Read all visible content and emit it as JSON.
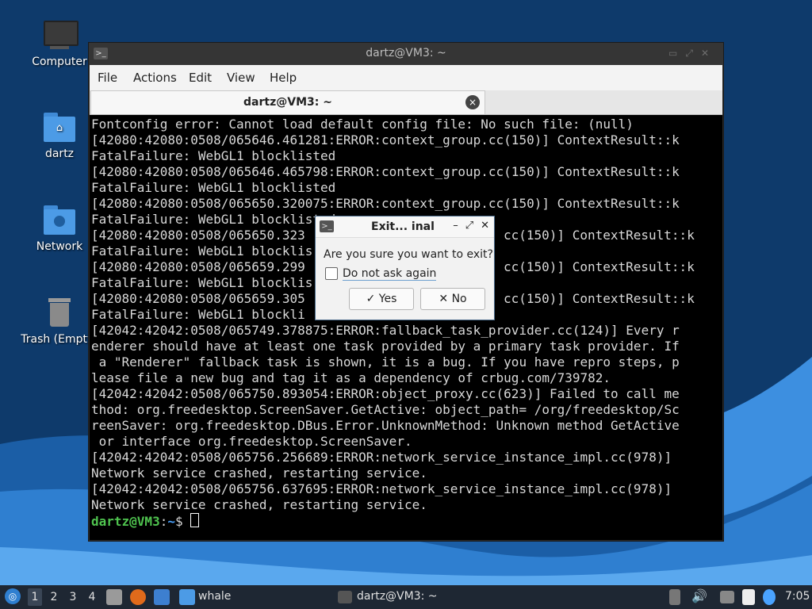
{
  "desktop": {
    "icons": [
      {
        "label": "Computer"
      },
      {
        "label": "dartz"
      },
      {
        "label": "Network"
      },
      {
        "label": "Trash (Empty)"
      }
    ]
  },
  "terminal": {
    "window_title": "dartz@VM3: ~",
    "menu": [
      "File",
      "Actions",
      "Edit",
      "View",
      "Help"
    ],
    "tab_title": "dartz@VM3: ~",
    "lines": [
      "Fontconfig error: Cannot load default config file: No such file: (null)",
      "[42080:42080:0508/065646.461281:ERROR:context_group.cc(150)] ContextResult::k",
      "FatalFailure: WebGL1 blocklisted",
      "[42080:42080:0508/065646.465798:ERROR:context_group.cc(150)] ContextResult::k",
      "FatalFailure: WebGL1 blocklisted",
      "[42080:42080:0508/065650.320075:ERROR:context_group.cc(150)] ContextResult::k",
      "FatalFailure: WebGL1 blocklisted",
      "[42080:42080:0508/065650.323",
      "FatalFailure: WebGL1 blocklis",
      "[42080:42080:0508/065659.299",
      "FatalFailure: WebGL1 blocklis",
      "[42080:42080:0508/065659.305",
      "FatalFailure: WebGL1 blockli",
      "[42042:42042:0508/065749.378875:ERROR:fallback_task_provider.cc(124)] Every r",
      "enderer should have at least one task provided by a primary task provider. If",
      " a \"Renderer\" fallback task is shown, it is a bug. If you have repro steps, p",
      "lease file a new bug and tag it as a dependency of crbug.com/739782.",
      "[42042:42042:0508/065750.893054:ERROR:object_proxy.cc(623)] Failed to call me",
      "thod: org.freedesktop.ScreenSaver.GetActive: object_path= /org/freedesktop/Sc",
      "reenSaver: org.freedesktop.DBus.Error.UnknownMethod: Unknown method GetActive",
      " or interface org.freedesktop.ScreenSaver.",
      "[42042:42042:0508/065756.256689:ERROR:network_service_instance_impl.cc(978)]",
      "Network service crashed, restarting service.",
      "[42042:42042:0508/065756.637695:ERROR:network_service_instance_impl.cc(978)]",
      "Network service crashed, restarting service."
    ],
    "partial_right": [
      {
        "row": 7,
        "text": "cc(150)] ContextResult::k"
      },
      {
        "row": 9,
        "text": "cc(150)] ContextResult::k"
      },
      {
        "row": 11,
        "text": "cc(150)] ContextResult::k"
      }
    ],
    "prompt": {
      "user": "dartz@VM3",
      "sep": ":",
      "path": "~",
      "symbol": "$ "
    }
  },
  "dialog": {
    "title": "Exit... inal",
    "question": "Are you sure you want to exit?",
    "checkbox_label": "Do not ask again",
    "yes_label": "Yes",
    "no_label": "No"
  },
  "taskbar": {
    "workspaces": [
      "1",
      "2",
      "3",
      "4"
    ],
    "folder_label": "whale",
    "task_label": "dartz@VM3: ~",
    "clock": "7:05"
  },
  "colors": {
    "terminal_bg": "#000000",
    "prompt_user": "#4fc34f",
    "prompt_path": "#4aa3ff",
    "taskbar_bg": "#1e2733"
  }
}
